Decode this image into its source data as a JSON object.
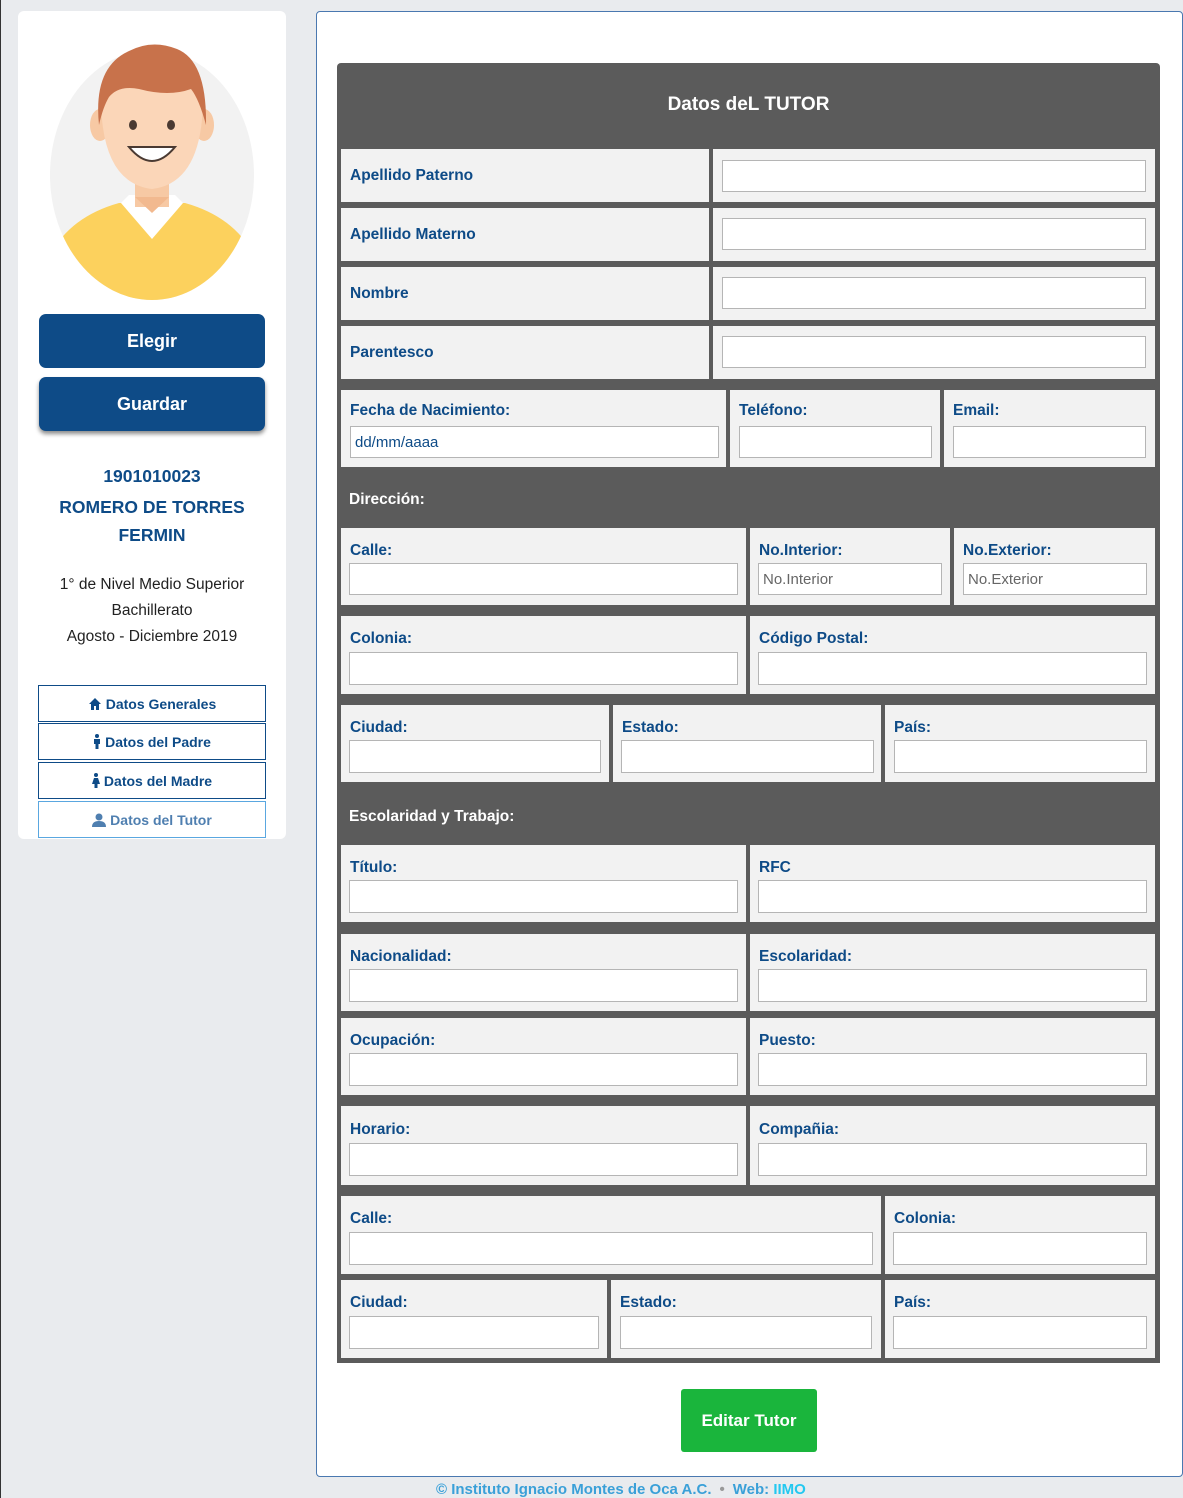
{
  "sidebar": {
    "buttons": {
      "choose": "Elegir",
      "save": "Guardar"
    },
    "student": {
      "id": "1901010023",
      "name_line1": "ROMERO DE TORRES",
      "name_line2": "FERMIN",
      "grade": "1° de Nivel Medio Superior",
      "program": "Bachillerato",
      "period": "Agosto - Diciembre 2019"
    },
    "nav": [
      {
        "label": "Datos Generales",
        "icon": "home-icon"
      },
      {
        "label": "Datos del Padre",
        "icon": "male-icon"
      },
      {
        "label": "Datos del Madre",
        "icon": "female-icon"
      },
      {
        "label": "Datos del Tutor",
        "icon": "user-icon",
        "active": true
      }
    ]
  },
  "form": {
    "title": "Datos deL TUTOR",
    "apellido_paterno": {
      "label": "Apellido Paterno",
      "value": ""
    },
    "apellido_materno": {
      "label": "Apellido Materno",
      "value": ""
    },
    "nombre": {
      "label": "Nombre",
      "value": ""
    },
    "parentesco": {
      "label": "Parentesco",
      "value": ""
    },
    "fecha_nacimiento": {
      "label": "Fecha de Nacimiento:",
      "value": "dd/mm/aaaa"
    },
    "telefono": {
      "label": "Teléfono:",
      "value": ""
    },
    "email": {
      "label": "Email:",
      "value": ""
    },
    "direccion_heading": "Dirección:",
    "calle": {
      "label": "Calle:",
      "value": ""
    },
    "no_interior": {
      "label": "No.Interior:",
      "placeholder": "No.Interior"
    },
    "no_exterior": {
      "label": "No.Exterior:",
      "placeholder": "No.Exterior"
    },
    "colonia": {
      "label": "Colonia:",
      "value": ""
    },
    "codigo_postal": {
      "label": "Código Postal:",
      "value": ""
    },
    "ciudad": {
      "label": "Ciudad:",
      "value": ""
    },
    "estado": {
      "label": "Estado:",
      "value": ""
    },
    "pais": {
      "label": "País:",
      "value": ""
    },
    "trabajo_heading": "Escolaridad y Trabajo:",
    "titulo": {
      "label": "Título:",
      "value": ""
    },
    "rfc": {
      "label": "RFC",
      "value": ""
    },
    "nacionalidad": {
      "label": "Nacionalidad:",
      "value": ""
    },
    "escolaridad": {
      "label": "Escolaridad:",
      "value": ""
    },
    "ocupacion": {
      "label": "Ocupación:",
      "value": ""
    },
    "puesto": {
      "label": "Puesto:",
      "value": ""
    },
    "horario": {
      "label": "Horario:",
      "value": ""
    },
    "compania": {
      "label": "Compañia:",
      "value": ""
    },
    "trabajo_calle": {
      "label": "Calle:",
      "value": ""
    },
    "trabajo_colonia": {
      "label": "Colonia:",
      "value": ""
    },
    "trabajo_ciudad": {
      "label": "Ciudad:",
      "value": ""
    },
    "trabajo_estado": {
      "label": "Estado:",
      "value": ""
    },
    "trabajo_pais": {
      "label": "País:",
      "value": ""
    },
    "submit": "Editar Tutor"
  },
  "footer": {
    "copyright": "© Instituto Ignacio Montes de Oca A.C.",
    "web_label": "Web:",
    "web_link": "IIMO"
  },
  "colors": {
    "primary": "#0e4b87",
    "header_bg": "#5b5b5b",
    "submit_green": "#1ab53c",
    "link_cyan": "#23c8f0"
  }
}
